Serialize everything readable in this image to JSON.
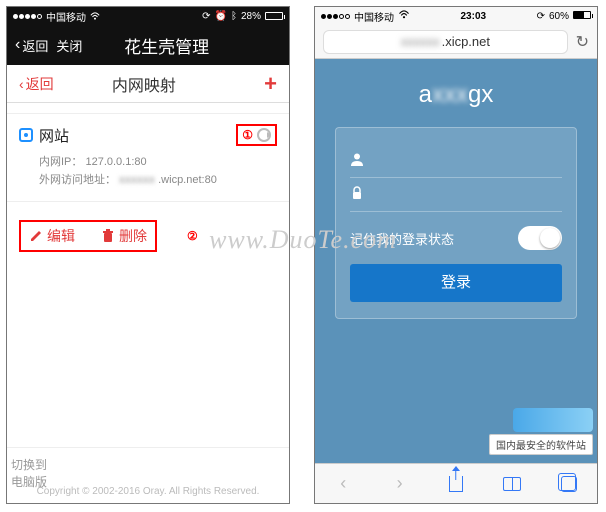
{
  "watermark": "www.DuoTe.com",
  "left": {
    "status": {
      "carrier": "中国移动",
      "battery_text": "28%"
    },
    "wechat_header": {
      "back": "返回",
      "close": "关闭",
      "title": "花生壳管理"
    },
    "sub_header": {
      "back": "返回",
      "center": "内网映射"
    },
    "annotations": {
      "num1": "①",
      "num2": "②"
    },
    "entry": {
      "title": "网站",
      "ip_label": "内网IP：",
      "ip_value": "127.0.0.1:80",
      "ext_label": "外网访问地址：",
      "ext_value_suffix": ".wicp.net:80"
    },
    "actions": {
      "edit": "编辑",
      "delete": "删除"
    },
    "footer": {
      "switch": "切换到电脑版",
      "copyright": "Copyright © 2002-2016 Oray. All Rights Reserved."
    }
  },
  "right": {
    "status": {
      "carrier": "中国移动",
      "time": "23:03",
      "battery_text": "60%"
    },
    "url": {
      "suffix": ".xicp.net"
    },
    "login": {
      "title_prefix": "a",
      "title_suffix": "gx",
      "remember": "记住我的登录状态",
      "submit": "登录"
    },
    "decor_caption": "国内最安全的软件站"
  }
}
